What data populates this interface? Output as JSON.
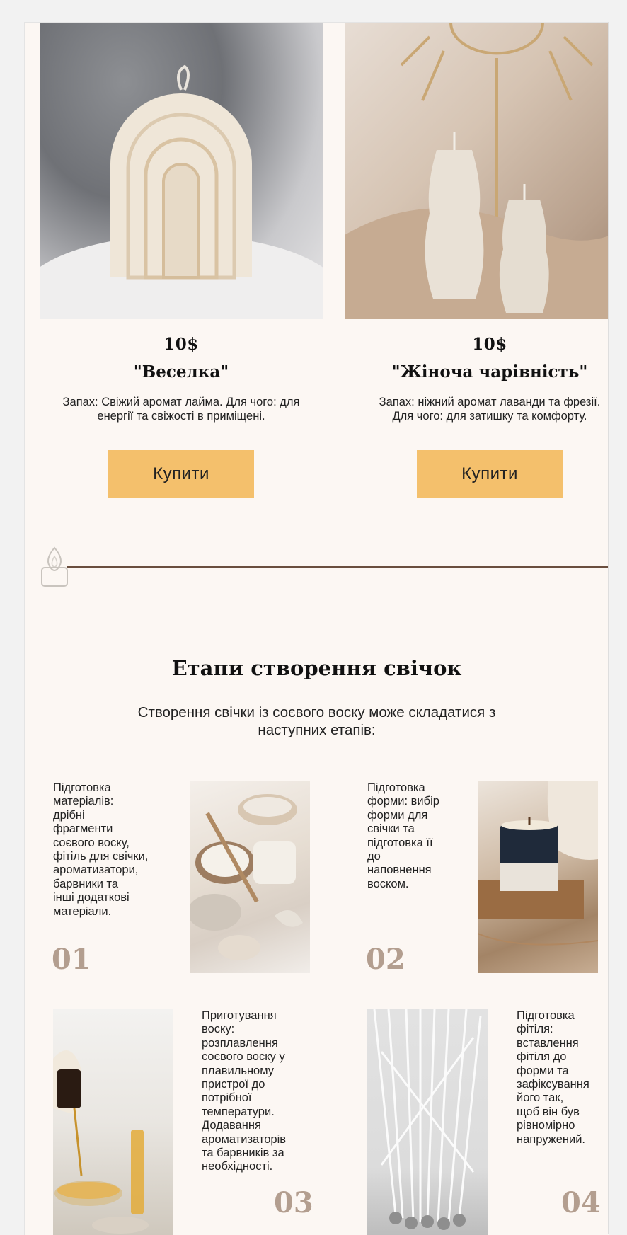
{
  "products": [
    {
      "price": "10$",
      "name": "\"Веселка\"",
      "description_line1": "Запах: Свіжий аромат лайма. Для чого: для",
      "description_line2": "енергії та свіжості в приміщені.",
      "buy_label": "Купити"
    },
    {
      "price": "10$",
      "name": "\"Жіноча чарівність\"",
      "description_line1": "Запах: ніжний аромат лаванди та фрезії.",
      "description_line2": "Для чого: для затишку та комфорту.",
      "buy_label": "Купити"
    }
  ],
  "steps_section": {
    "title": "Етапи створення свічок",
    "subtitle_line1": "Створення свічки із соєвого воску може складатися з",
    "subtitle_line2": "наступних етапів:"
  },
  "steps": [
    {
      "number": "01",
      "lines": [
        "Підготовка",
        "матеріалів:",
        "дрібні",
        "фрагменти",
        "соєвого воску,",
        "фітіль для свічки,",
        "ароматизатори,",
        "барвники та",
        "інші додаткові",
        "матеріали."
      ]
    },
    {
      "number": "02",
      "lines": [
        "Підготовка",
        "форми: вибір",
        "форми для",
        "свічки та",
        "підготовка її",
        "до",
        "наповнення",
        "воском."
      ]
    },
    {
      "number": "03",
      "lines": [
        "Приготування",
        "воску:",
        "розплавлення",
        "соєвого воску у",
        "плавильному",
        "пристрої до",
        "потрібної",
        "температури.",
        "Додавання",
        "ароматизаторів",
        "та барвників за",
        "необхідності."
      ]
    },
    {
      "number": "04",
      "lines": [
        "Підготовка",
        "фітіля:",
        "вставлення",
        "фітіля до",
        "форми та",
        "зафіксування",
        "його так,",
        "щоб він був",
        "рівномірно",
        "напружений."
      ]
    }
  ],
  "colors": {
    "page_background": "#fcf7f3",
    "button": "#f4c06c",
    "step_number": "#b39e8f",
    "divider_line": "#6a4e3e"
  },
  "icons": {
    "divider": "candle-icon"
  }
}
